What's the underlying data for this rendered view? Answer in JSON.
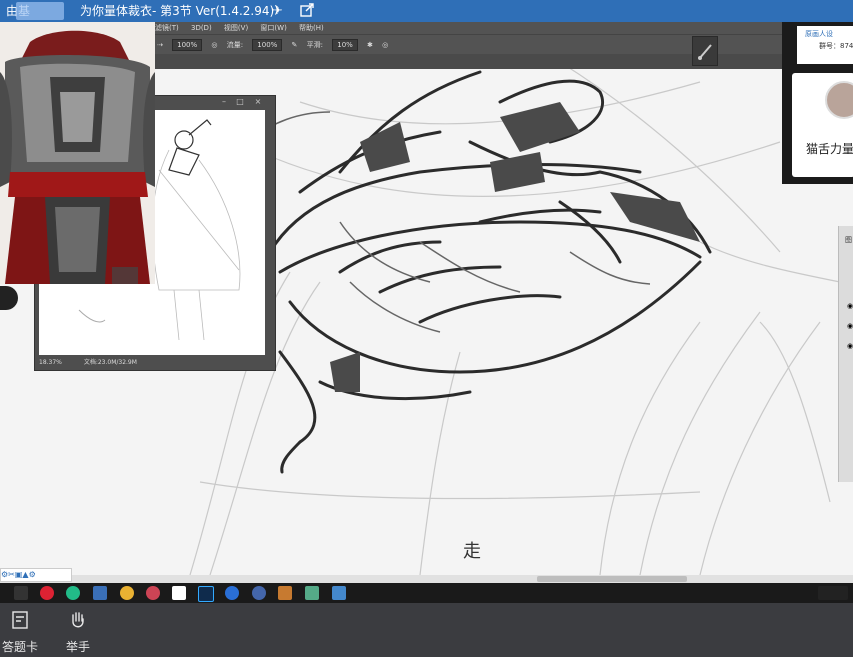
{
  "window": {
    "title_prefix": "由基",
    "title_suffix": "为你量体裁衣- 第3节 Ver(1.4.2.94)"
  },
  "ps": {
    "menus": [
      "滤镜(T)",
      "3D(D)",
      "视图(V)",
      "窗口(W)",
      "帮助(H)"
    ],
    "options": {
      "opacity_value": "100%",
      "flow_label": "流量:",
      "flow_value": "100%",
      "smooth_label": "平滑:",
      "smooth_value": "10%"
    }
  },
  "navigator": {
    "zoom": "18.37%",
    "doc": "文档:23.0M/32.9M"
  },
  "subtitle": "走",
  "right_panel": {
    "card1_line1": "原画人设",
    "card1_line2": "群号：874",
    "card2_name": "猫舌力量",
    "layers_label": "图"
  },
  "bottom": {
    "answer_label": "答题卡",
    "raise_hand_label": "举手"
  },
  "icons": {
    "plane": "send-icon",
    "share": "share-icon"
  }
}
